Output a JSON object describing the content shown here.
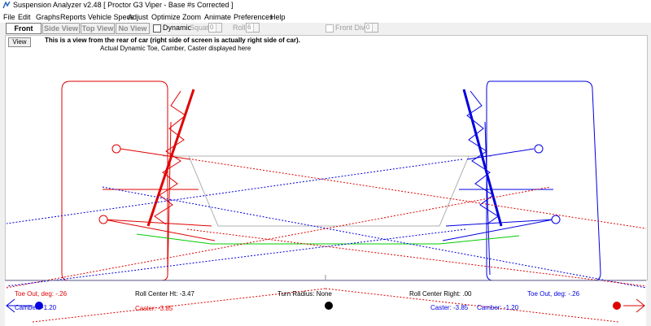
{
  "window": {
    "title": "Suspension Analyzer v2.48    [ Proctor G3 Viper - Base #s Corrected ]"
  },
  "menu": [
    "File",
    "Edit",
    "Graphs",
    "Reports",
    "Vehicle Specs",
    "Adjust",
    "Optimize",
    "Zoom",
    "Animate",
    "Preferences",
    "Help"
  ],
  "toolbar": {
    "tabs": [
      "Front View",
      "Side View",
      "Top View",
      "No View"
    ],
    "dynamic_label": "Dynamic",
    "squat_label": "Squat",
    "squat_value": "0",
    "roll_label": "Roll",
    "roll_value": "6",
    "front_dive_label": "Front Dive",
    "front_dive_value": "0"
  },
  "canvas": {
    "view_button": "View",
    "note_line1": "This is a view from the rear of car (right side of screen is actually right side of car).",
    "note_line2": "Actual Dynamic Toe, Camber, Caster displayed here"
  },
  "readouts": {
    "left_toe": "Toe Out, deg: -.26",
    "left_camber": "Camber: -1.20",
    "left_caster": "Caster: -3.85",
    "roll_center_ht": "Roll Center Ht: -3.47",
    "turn_radius": "Turn Radius: None",
    "roll_center_right": "Roll Center Right: .00",
    "right_toe": "Toe Out, deg: -.26",
    "right_caster": "Caster: -3.85",
    "right_camber": "Camber: -1.20"
  },
  "colors": {
    "left": "#e00000",
    "right": "#0000e0",
    "roll_center_line": "#00cc00",
    "chassis": "#b0b0b0"
  }
}
